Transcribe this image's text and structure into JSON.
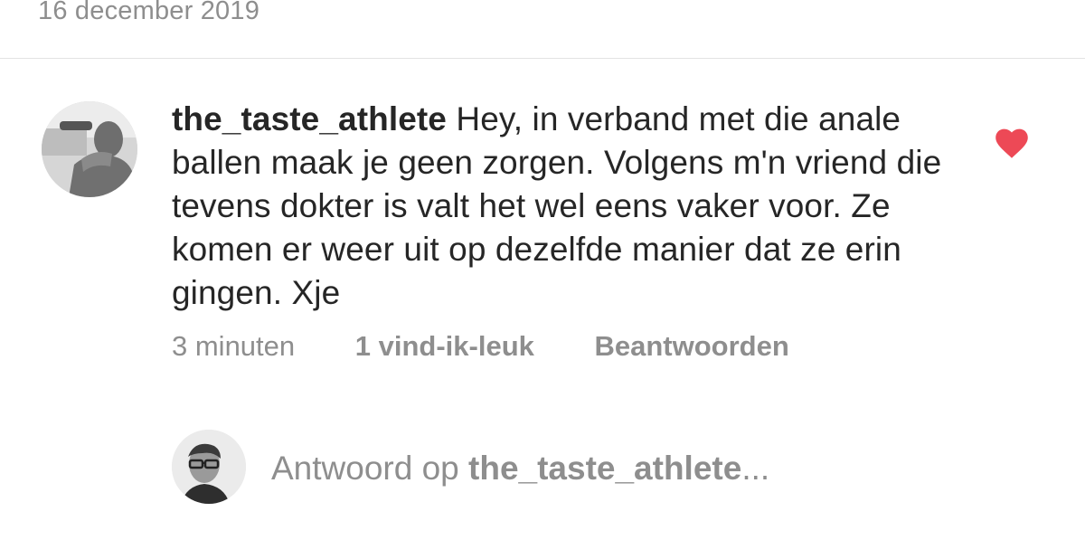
{
  "post": {
    "date": "16 december 2019"
  },
  "comment": {
    "username": "the_taste_athlete",
    "text": "Hey, in verband met die anale ballen maak je geen zorgen. Volgens m'n vriend die tevens dokter is valt het wel eens vaker voor. Ze komen er weer uit op dezelfde manier dat ze erin gingen. Xje",
    "time": "3 minuten",
    "likes": "1 vind-ik-leuk",
    "reply_label": "Beantwoorden",
    "liked": true,
    "heart_color": "#ed4956"
  },
  "reply_box": {
    "prefix": "Antwoord op ",
    "mention": "the_taste_athlete",
    "ellipsis": "..."
  },
  "colors": {
    "text": "#262626",
    "secondary": "#8e8e8e",
    "divider": "#e3e3e3"
  }
}
